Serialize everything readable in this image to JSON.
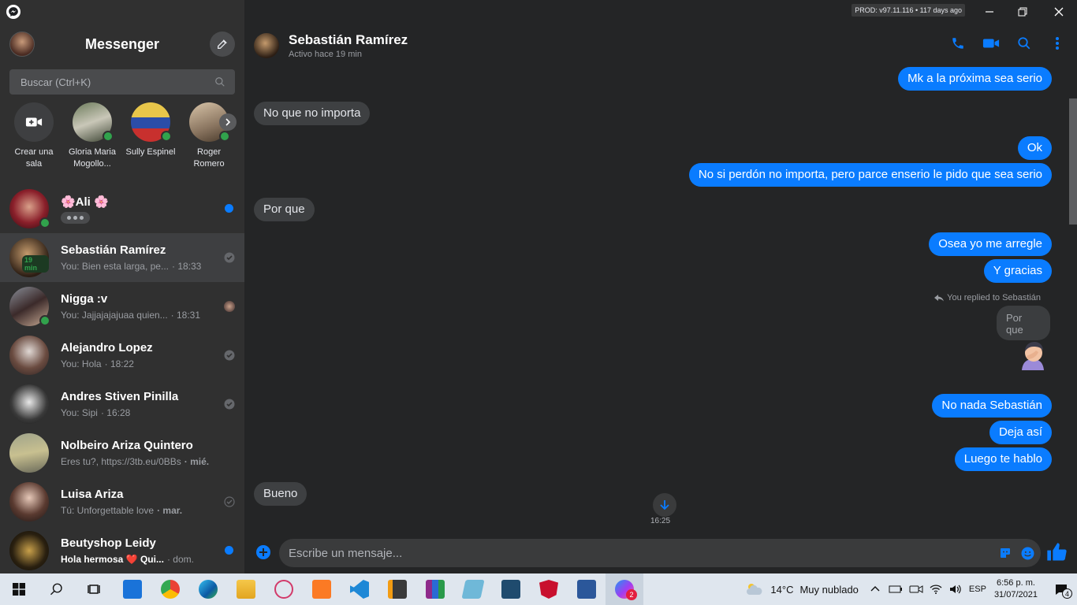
{
  "app": {
    "title": "Messenger",
    "build_badge": "PROD: v97.11.116 • 117 days ago"
  },
  "sidebar": {
    "search_placeholder": "Buscar (Ctrl+K)",
    "stories": [
      {
        "label": "Crear una sala"
      },
      {
        "label": "Gloria Maria Mogollo..."
      },
      {
        "label": "Sully Espinel"
      },
      {
        "label": "Roger Romero"
      }
    ],
    "conversations": [
      {
        "name": "🌸Ali 🌸",
        "preview": "",
        "time": "",
        "typing": true
      },
      {
        "name": "Sebastián Ramírez",
        "preview": "You: Bien esta larga, pe...",
        "time": "· 18:33",
        "badge": "19 min"
      },
      {
        "name": "Nigga :v",
        "preview": "You: Jajjajajajuaa quien...",
        "time": "· 18:31"
      },
      {
        "name": "Alejandro Lopez",
        "preview": "You: Hola",
        "time": "· 18:22"
      },
      {
        "name": "Andres Stiven Pinilla",
        "preview": "You: Sipi",
        "time": "· 16:28"
      },
      {
        "name": "Nolbeiro Ariza Quintero",
        "preview": "Eres tu?, https://3tb.eu/0BBs",
        "time": "· mié."
      },
      {
        "name": "Luisa Ariza",
        "preview": "Tú: Unforgettable love",
        "time": "· mar."
      },
      {
        "name": "Beutyshop Leidy",
        "preview": "Hola hermosa ❤️ Qui...",
        "time": "· dom."
      }
    ]
  },
  "chat": {
    "contact_name": "Sebastián Ramírez",
    "contact_status": "Activo hace 19 min",
    "messages": {
      "m1": "Mk a la próxima sea serio",
      "m2": "No que no importa",
      "m3": "Ok",
      "m4": "No si perdón no importa, pero parce enserio le pido que sea serio",
      "m5": "Por que",
      "m6": "Osea yo me arregle",
      "m7": "Y gracias",
      "reply_note": "You replied to Sebastián",
      "reply_quote": "Por que",
      "m8": "No nada Sebastián",
      "m9": "Deja así",
      "m10": "Luego te hablo",
      "m11": "Bueno"
    },
    "time_label": "16:25",
    "composer_placeholder": "Escribe un mensaje..."
  },
  "taskbar": {
    "temperature": "14°C",
    "weather": "Muy nublado",
    "language": "ESP",
    "time": "6:56 p. m.",
    "date": "31/07/2021",
    "messenger_badge": "2",
    "notification_count": "4"
  },
  "colors": {
    "accent": "#0a7cff",
    "online": "#31a24c",
    "sidebar_bg": "#303030",
    "chat_bg": "#242526"
  }
}
